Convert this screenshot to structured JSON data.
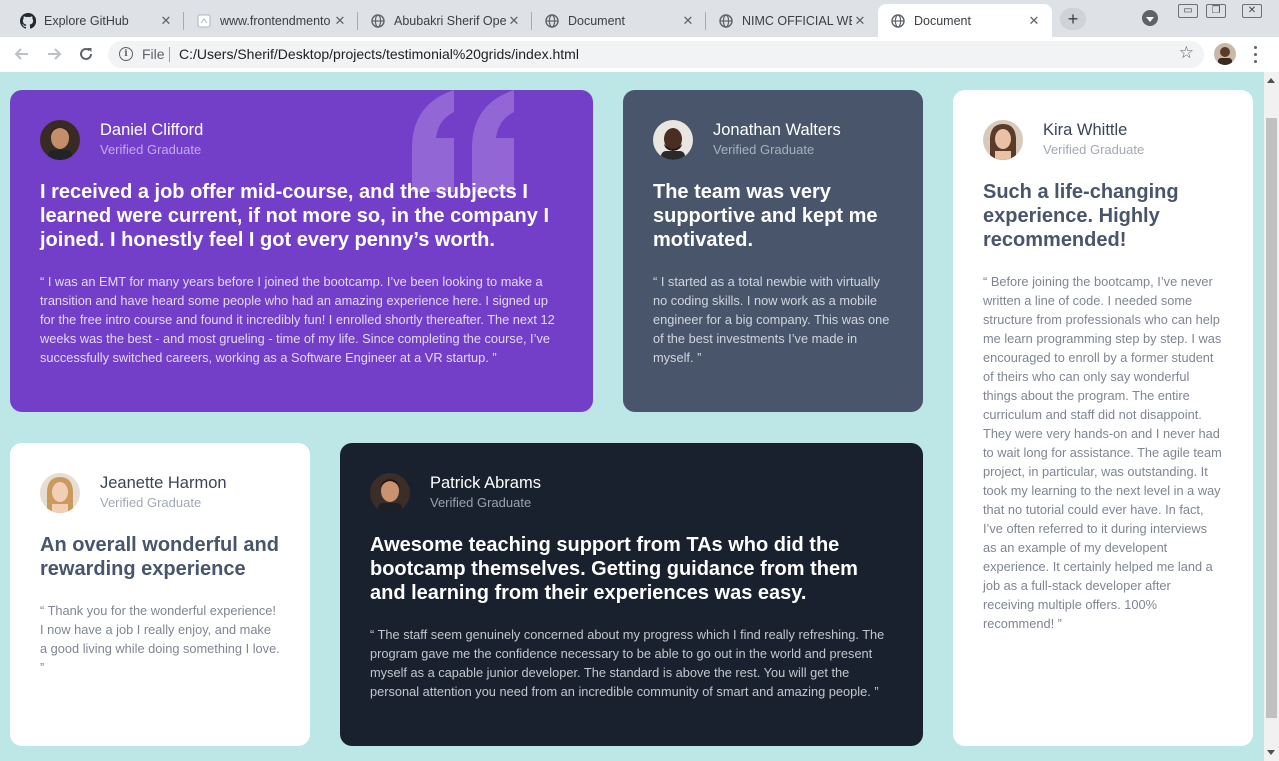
{
  "browser": {
    "tabs": [
      {
        "title": "Explore GitHub",
        "favicon": "github-icon",
        "active": false
      },
      {
        "title": "www.frontendmento",
        "favicon": "page-icon",
        "active": false
      },
      {
        "title": "Abubakri Sherif Ope",
        "favicon": "globe-icon",
        "active": false
      },
      {
        "title": "Document",
        "favicon": "globe-icon",
        "active": false
      },
      {
        "title": "NIMC OFFICIAL WEB",
        "favicon": "globe-icon",
        "active": false
      },
      {
        "title": "Document",
        "favicon": "globe-icon",
        "active": true
      }
    ],
    "new_tab_label": "+",
    "address_bar": {
      "scheme_label": "File",
      "url": "C:/Users/Sherif/Desktop/projects/testimonial%20grids/index.html"
    }
  },
  "colors": {
    "background": "#bde6e6",
    "purple": "#733fc8",
    "gray_blue": "#48556a",
    "dark_navy": "#19212e",
    "white": "#ffffff"
  },
  "testimonials": [
    {
      "name": "Daniel Clifford",
      "role": "Verified Graduate",
      "headline": "I received a job offer mid-course, and the subjects I learned were current, if not more so, in the company I joined. I honestly feel I got every penny’s worth.",
      "body": "“ I was an EMT for many years before I joined the bootcamp. I’ve been looking to make a transition and have heard some people who had an amazing experience here. I signed up for the free intro course and found it incredibly fun! I enrolled shortly thereafter. The next 12 weeks was the best - and most grueling - time of my life. Since completing the course, I’ve successfully switched careers, working as a Software Engineer at a VR startup. ”"
    },
    {
      "name": "Jonathan Walters",
      "role": "Verified Graduate",
      "headline": "The team was very supportive and kept me motivated.",
      "body": "“ I started as a total newbie with virtually no coding skills. I now work as a mobile engineer for a big company. This was one of the best investments I’ve made in myself. ”"
    },
    {
      "name": "Kira Whittle",
      "role": "Verified Graduate",
      "headline": "Such a life-changing experience. Highly recommended!",
      "body": "“ Before joining the bootcamp, I’ve never written a line of code. I needed some structure from professionals who can help me learn programming step by step. I was encouraged to enroll by a former student of theirs who can only say wonderful things about the program. The entire curriculum and staff did not disappoint. They were very hands-on and I never had to wait long for assistance. The agile team project, in particular, was outstanding. It took my learning to the next level in a way that no tutorial could ever have. In fact, I’ve often referred to it during interviews as an example of my developent experience. It certainly helped me land a job as a full-stack developer after receiving multiple offers. 100% recommend! ”"
    },
    {
      "name": "Jeanette Harmon",
      "role": "Verified Graduate",
      "headline": "An overall wonderful and rewarding experience",
      "body": "“ Thank you for the wonderful experience! I now have a job I really enjoy, and make a good living while doing something I love. ”"
    },
    {
      "name": "Patrick Abrams",
      "role": "Verified Graduate",
      "headline": "Awesome teaching support from TAs who did the bootcamp themselves. Getting guidance from them and learning from their experiences was easy.",
      "body": "“ The staff seem genuinely concerned about my progress which I find really refreshing. The program gave me the confidence necessary to be able to go out in the world and present myself as a capable junior developer. The standard is above the rest. You will get the personal attention you need from an incredible community of smart and amazing people. ”"
    }
  ]
}
